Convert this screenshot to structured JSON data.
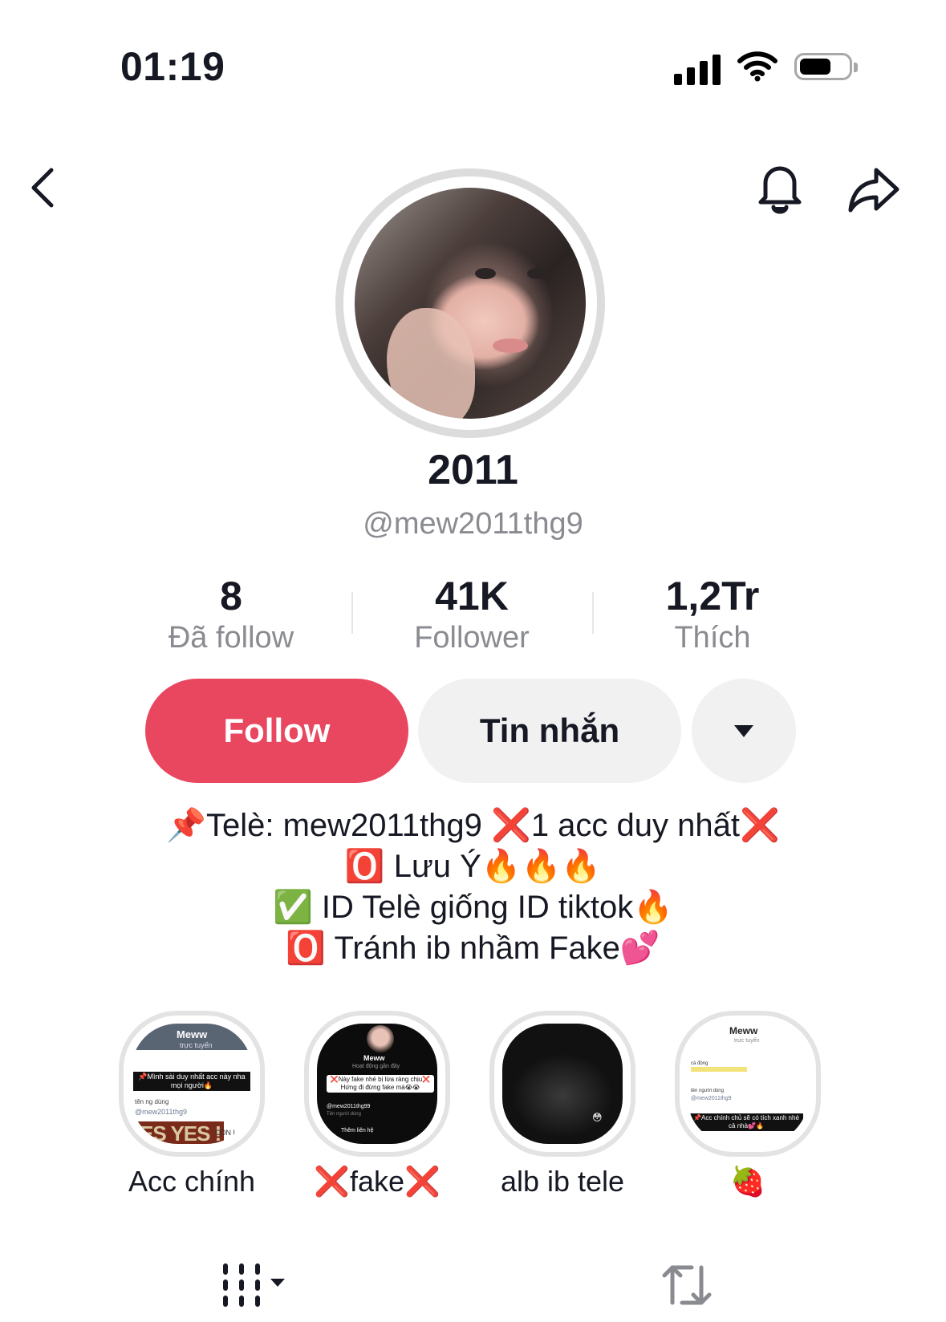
{
  "status_bar": {
    "time": "01:19"
  },
  "profile": {
    "display_name": "2011",
    "handle": "@mew2011thg9"
  },
  "stats": [
    {
      "value": "8",
      "label": "Đã follow"
    },
    {
      "value": "41K",
      "label": "Follower"
    },
    {
      "value": "1,2Tr",
      "label": "Thích"
    }
  ],
  "actions": {
    "follow_label": "Follow",
    "message_label": "Tin nhắn",
    "follow_color": "#e9465f"
  },
  "bio": [
    "📌Telè: mew2011thg9 ❌1 acc duy nhất❌",
    "🅾️ Lưu Ý🔥🔥🔥",
    "✅ ID Telè giống ID tiktok🔥",
    "🅾️ Tránh ib nhầm Fake💕"
  ],
  "highlights": [
    {
      "label": "Acc chính",
      "thumb": {
        "name": "Meww",
        "status": "trực tuyến",
        "caption": "📌Mình sài duy nhất acc này nha mọi người🔥",
        "username_label": "tên ng dùng",
        "username": "@mew2011thg9",
        "overlay_big": "ES YES !",
        "overlay_small": "CÒN LAI"
      }
    },
    {
      "label": "❌fake❌",
      "thumb": {
        "name": "Meww",
        "status": "Hoạt động gần đây",
        "caption": "❌Này fake nhé bị lừa ráng chịu❌ Hứng đi đừng fake mà😭😭",
        "username": "@mew2011thg99",
        "username_label": "Tên người dùng",
        "more": "Thêm liên hệ"
      }
    },
    {
      "label": "alb ib tele",
      "thumb": {
        "emoji": "😳"
      }
    },
    {
      "label": "🍓",
      "thumb": {
        "name": "Meww",
        "status": "trực tuyến",
        "bio_label": "cà động",
        "username_label": "tên người dùng",
        "username": "@mew2011thg9",
        "caption": "📌Acc chính chủ sẽ có tích xanh nhé cả nhà💕🔥"
      }
    }
  ],
  "icons": {
    "back": "chevron-left-icon",
    "bell": "bell-icon",
    "share": "share-icon",
    "more": "caret-down-icon",
    "grid_tab": "grid-icon",
    "repost_tab": "repost-icon"
  }
}
